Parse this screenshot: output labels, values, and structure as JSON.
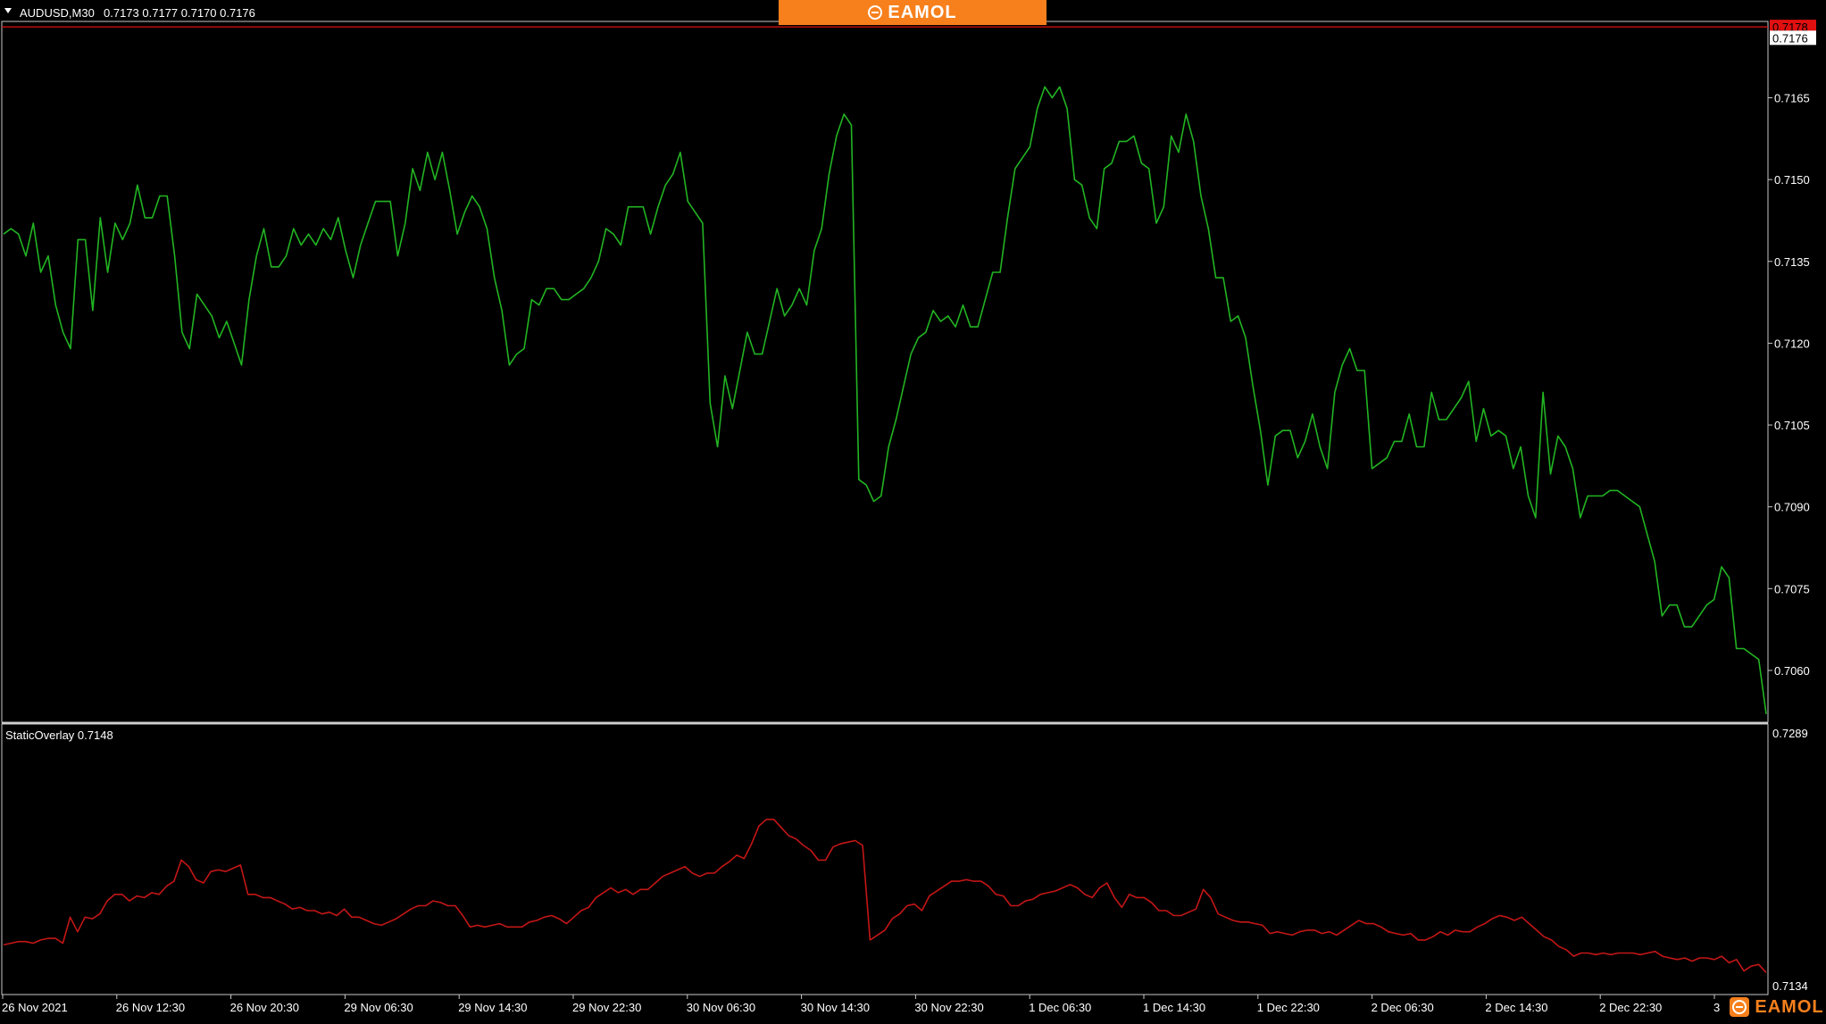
{
  "brand": {
    "name": "EAMOL",
    "icon": "eamol-logo-icon",
    "color": "#f7801c"
  },
  "chart_data": [
    {
      "type": "line",
      "symbol_label": "AUDUSD,M30",
      "ohlc_label": "0.7173 0.7177 0.7170 0.7176",
      "title": "AUDUSD,M30 0.7173 0.7177 0.7170 0.7176",
      "color": "#22b422",
      "ylim": [
        0.70505,
        0.7179
      ],
      "yticks": [
        "0.7165",
        "0.7150",
        "0.7135",
        "0.7120",
        "0.7105",
        "0.7090",
        "0.7075",
        "0.7060"
      ],
      "price_tags": [
        {
          "value": 0.7178,
          "label": "0.7178",
          "bg": "#e01010",
          "fg": "#000000"
        },
        {
          "value": 0.7176,
          "label": "0.7176",
          "bg": "#ffffff",
          "fg": "#000000"
        }
      ],
      "values": [
        0.714,
        0.7141,
        0.714,
        0.7136,
        0.7142,
        0.7133,
        0.7136,
        0.7127,
        0.7122,
        0.7119,
        0.7139,
        0.7139,
        0.7126,
        0.7143,
        0.7133,
        0.7142,
        0.7139,
        0.7142,
        0.7149,
        0.7143,
        0.7143,
        0.7147,
        0.7147,
        0.7136,
        0.7122,
        0.7119,
        0.7129,
        0.7127,
        0.7125,
        0.7121,
        0.7124,
        0.712,
        0.7116,
        0.7128,
        0.7136,
        0.7141,
        0.7134,
        0.7134,
        0.7136,
        0.7141,
        0.7138,
        0.714,
        0.7138,
        0.7141,
        0.7139,
        0.7143,
        0.7137,
        0.7132,
        0.7138,
        0.7142,
        0.7146,
        0.7146,
        0.7146,
        0.7136,
        0.7142,
        0.7152,
        0.7148,
        0.7155,
        0.715,
        0.7155,
        0.7148,
        0.714,
        0.7144,
        0.7147,
        0.7145,
        0.7141,
        0.7132,
        0.7126,
        0.7116,
        0.7118,
        0.7119,
        0.7128,
        0.7127,
        0.713,
        0.713,
        0.7128,
        0.7128,
        0.7129,
        0.713,
        0.7132,
        0.7135,
        0.7141,
        0.714,
        0.7138,
        0.7145,
        0.7145,
        0.7145,
        0.714,
        0.7145,
        0.7149,
        0.7151,
        0.7155,
        0.7146,
        0.7144,
        0.7142,
        0.7109,
        0.7101,
        0.7114,
        0.7108,
        0.7115,
        0.7122,
        0.7118,
        0.7118,
        0.7124,
        0.713,
        0.7125,
        0.7127,
        0.713,
        0.7127,
        0.7137,
        0.7141,
        0.7151,
        0.7158,
        0.7162,
        0.716,
        0.7095,
        0.7094,
        0.7091,
        0.7092,
        0.7101,
        0.7106,
        0.7112,
        0.7118,
        0.7121,
        0.7122,
        0.7126,
        0.7124,
        0.7125,
        0.7123,
        0.7127,
        0.7123,
        0.7123,
        0.7128,
        0.7133,
        0.7133,
        0.7143,
        0.7152,
        0.7154,
        0.7156,
        0.7163,
        0.7167,
        0.7165,
        0.7167,
        0.7163,
        0.715,
        0.7149,
        0.7143,
        0.7141,
        0.7152,
        0.7153,
        0.7157,
        0.7157,
        0.7158,
        0.7153,
        0.7152,
        0.7142,
        0.7145,
        0.7158,
        0.7155,
        0.7162,
        0.7157,
        0.7147,
        0.7141,
        0.7132,
        0.7132,
        0.7124,
        0.7125,
        0.7121,
        0.7112,
        0.7104,
        0.7094,
        0.7103,
        0.7104,
        0.7104,
        0.7099,
        0.7102,
        0.7107,
        0.7101,
        0.7097,
        0.7111,
        0.7116,
        0.7119,
        0.7115,
        0.7115,
        0.7097,
        0.7098,
        0.7099,
        0.7102,
        0.7102,
        0.7107,
        0.7101,
        0.7101,
        0.7111,
        0.7106,
        0.7106,
        0.7108,
        0.711,
        0.7113,
        0.7102,
        0.7108,
        0.7103,
        0.7104,
        0.7103,
        0.7097,
        0.7101,
        0.7092,
        0.7088,
        0.7111,
        0.7096,
        0.7103,
        0.7101,
        0.7097,
        0.7088,
        0.7092,
        0.7092,
        0.7092,
        0.7093,
        0.7093,
        0.7092,
        0.7091,
        0.709,
        0.7085,
        0.708,
        0.707,
        0.7072,
        0.7072,
        0.7068,
        0.7068,
        0.707,
        0.7072,
        0.7073,
        0.7079,
        0.7077,
        0.7064,
        0.7064,
        0.7063,
        0.7062,
        0.7052
      ]
    },
    {
      "type": "line",
      "indicator_label": "StaticOverlay 0.7148",
      "title": "StaticOverlay 0.7148",
      "color": "#c41616",
      "ylim": [
        0.7134,
        0.7289
      ],
      "yticks": [
        "0.7289",
        "0.7134"
      ],
      "values": [
        0.7159,
        0.716,
        0.7161,
        0.7161,
        0.716,
        0.7162,
        0.7163,
        0.7163,
        0.716,
        0.7176,
        0.7167,
        0.7176,
        0.7175,
        0.7178,
        0.7186,
        0.719,
        0.719,
        0.7186,
        0.7189,
        0.7188,
        0.7191,
        0.719,
        0.7195,
        0.7198,
        0.7211,
        0.7207,
        0.7199,
        0.7197,
        0.7204,
        0.7205,
        0.7204,
        0.7206,
        0.7208,
        0.719,
        0.719,
        0.7188,
        0.7188,
        0.7186,
        0.7184,
        0.7181,
        0.7182,
        0.718,
        0.718,
        0.7178,
        0.7179,
        0.7177,
        0.7181,
        0.7176,
        0.7176,
        0.7174,
        0.7172,
        0.7171,
        0.7173,
        0.7175,
        0.7178,
        0.7181,
        0.7183,
        0.7183,
        0.7186,
        0.7185,
        0.7183,
        0.7183,
        0.7177,
        0.717,
        0.7171,
        0.717,
        0.7171,
        0.7172,
        0.717,
        0.717,
        0.717,
        0.7173,
        0.7174,
        0.7176,
        0.7177,
        0.7175,
        0.7172,
        0.7176,
        0.718,
        0.7182,
        0.7188,
        0.7191,
        0.7194,
        0.7191,
        0.7193,
        0.719,
        0.7193,
        0.7193,
        0.7197,
        0.7201,
        0.7203,
        0.7205,
        0.7207,
        0.7203,
        0.7201,
        0.7203,
        0.7203,
        0.7207,
        0.721,
        0.7214,
        0.7212,
        0.7221,
        0.7232,
        0.7236,
        0.7236,
        0.7231,
        0.7226,
        0.7224,
        0.722,
        0.7217,
        0.7211,
        0.7211,
        0.7219,
        0.7221,
        0.7222,
        0.7223,
        0.722,
        0.7162,
        0.7165,
        0.7168,
        0.7175,
        0.7178,
        0.7183,
        0.7184,
        0.718,
        0.7189,
        0.7192,
        0.7195,
        0.7198,
        0.7198,
        0.7199,
        0.7198,
        0.7198,
        0.7195,
        0.719,
        0.7189,
        0.7183,
        0.7183,
        0.7186,
        0.7187,
        0.719,
        0.7191,
        0.7192,
        0.7194,
        0.7196,
        0.7194,
        0.719,
        0.7188,
        0.7194,
        0.7197,
        0.7188,
        0.7182,
        0.719,
        0.7188,
        0.7188,
        0.7185,
        0.718,
        0.718,
        0.7177,
        0.7177,
        0.7179,
        0.7181,
        0.7193,
        0.7188,
        0.7178,
        0.7176,
        0.7174,
        0.7173,
        0.7173,
        0.7172,
        0.7171,
        0.7166,
        0.7167,
        0.7166,
        0.7165,
        0.7167,
        0.7168,
        0.7168,
        0.7166,
        0.7167,
        0.7165,
        0.7168,
        0.7171,
        0.7174,
        0.7172,
        0.7172,
        0.717,
        0.7167,
        0.7166,
        0.7165,
        0.7166,
        0.7162,
        0.7162,
        0.7164,
        0.7167,
        0.7165,
        0.7168,
        0.7167,
        0.7167,
        0.717,
        0.7172,
        0.7175,
        0.7177,
        0.7176,
        0.7174,
        0.7176,
        0.7172,
        0.7168,
        0.7164,
        0.7162,
        0.7158,
        0.7156,
        0.7152,
        0.7154,
        0.7154,
        0.7153,
        0.7154,
        0.7153,
        0.7154,
        0.7154,
        0.7154,
        0.7153,
        0.7154,
        0.7155,
        0.7152,
        0.7151,
        0.715,
        0.7151,
        0.7149,
        0.7151,
        0.7151,
        0.715,
        0.7152,
        0.7148,
        0.715,
        0.7143,
        0.7146,
        0.7147,
        0.7142
      ]
    }
  ],
  "x_axis": {
    "labels": [
      "26 Nov 2021",
      "26 Nov 12:30",
      "26 Nov 20:30",
      "29 Nov 06:30",
      "29 Nov 14:30",
      "29 Nov 22:30",
      "30 Nov 06:30",
      "30 Nov 14:30",
      "30 Nov 22:30",
      "1 Dec 06:30",
      "1 Dec 14:30",
      "1 Dec 22:30",
      "2 Dec 06:30",
      "2 Dec 14:30",
      "2 Dec 22:30",
      "3"
    ]
  }
}
